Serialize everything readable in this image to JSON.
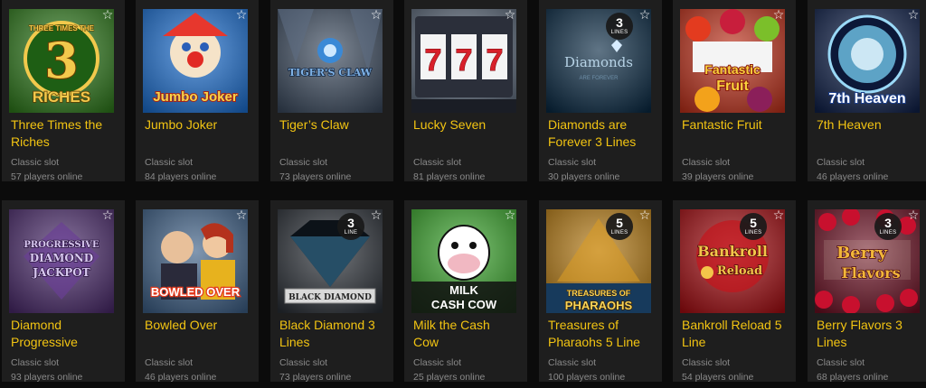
{
  "games": [
    {
      "title": "Three Times the Riches",
      "category": "Classic slot",
      "players": "57 players online",
      "art_text": [
        "THREE TIMES THE",
        "3",
        "RICHES"
      ],
      "colors": {
        "bg": "#2f7a1c",
        "accent": "#f2c94c"
      },
      "badge": null
    },
    {
      "title": "Jumbo Joker",
      "category": "Classic slot",
      "players": "84 players online",
      "art_text": [
        "Jumbo Joker"
      ],
      "colors": {
        "bg": "#1c6fd1",
        "accent": "#f7d54a"
      },
      "badge": null
    },
    {
      "title": "Tiger’s Claw",
      "category": "Classic slot",
      "players": "73 players online",
      "art_text": [
        "TIGER'S CLAW"
      ],
      "colors": {
        "bg": "#3b4a5e",
        "accent": "#7fb2e6"
      },
      "badge": null
    },
    {
      "title": "Lucky Seven",
      "category": "Classic slot",
      "players": "81 players online",
      "art_text": [
        "7",
        "7",
        "7"
      ],
      "colors": {
        "bg": "#5a6778",
        "accent": "#d8202a"
      },
      "badge": null
    },
    {
      "title": "Diamonds are Forever 3 Lines",
      "category": "Classic slot",
      "players": "30 players online",
      "art_text": [
        "Diamonds",
        "ARE FOREVER"
      ],
      "colors": {
        "bg": "#0a2a44",
        "accent": "#b7d3e6"
      },
      "badge": {
        "num": "3",
        "label": "LINES"
      }
    },
    {
      "title": "Fantastic Fruit",
      "category": "Classic slot",
      "players": "39 players online",
      "art_text": [
        "Fantastic",
        "Fruit"
      ],
      "colors": {
        "bg": "#c0321c",
        "accent": "#f9d23d"
      },
      "badge": null
    },
    {
      "title": "7th Heaven",
      "category": "Classic slot",
      "players": "46 players online",
      "art_text": [
        "7th Heaven"
      ],
      "colors": {
        "bg": "#10214a",
        "accent": "#78d1f5"
      },
      "badge": null
    },
    {
      "title": "Diamond Progressive",
      "category": "Classic slot",
      "players": "93 players online",
      "art_text": [
        "PROGRESSIVE",
        "DIAMOND",
        "JACKPOT"
      ],
      "colors": {
        "bg": "#4a2a6b",
        "accent": "#d8c8f0"
      },
      "badge": null
    },
    {
      "title": "Bowled Over",
      "category": "Classic slot",
      "players": "46 players online",
      "art_text": [
        "BOWLED OVER"
      ],
      "colors": {
        "bg": "#3d5f86",
        "accent": "#e33b1f"
      },
      "badge": null
    },
    {
      "title": "Black Diamond 3 Lines",
      "category": "Classic slot",
      "players": "73 players online",
      "art_text": [
        "BLACK DIAMOND"
      ],
      "colors": {
        "bg": "#2a2f36",
        "accent": "#3d7fa8"
      },
      "badge": {
        "num": "3",
        "label": "LINE"
      }
    },
    {
      "title": "Milk the Cash Cow",
      "category": "Classic slot",
      "players": "25 players online",
      "art_text": [
        "MILK",
        "CASH COW"
      ],
      "colors": {
        "bg": "#3aa52c",
        "accent": "#ffffff"
      },
      "badge": null
    },
    {
      "title": "Treasures of Pharaohs 5 Line",
      "category": "Classic slot",
      "players": "100 players online",
      "art_text": [
        "TREASURES OF",
        "PHARAOHS"
      ],
      "colors": {
        "bg": "#b57a12",
        "accent": "#f6d35a"
      },
      "badge": {
        "num": "5",
        "label": "LINES"
      }
    },
    {
      "title": "Bankroll Reload 5 Line",
      "category": "Classic slot",
      "players": "54 players online",
      "art_text": [
        "Bankroll",
        "Reload"
      ],
      "colors": {
        "bg": "#a50d12",
        "accent": "#f3c54a"
      },
      "badge": {
        "num": "5",
        "label": "LINES"
      }
    },
    {
      "title": "Berry Flavors 3 Lines",
      "category": "Classic slot",
      "players": "68 players online",
      "art_text": [
        "Berry",
        "Flavors"
      ],
      "colors": {
        "bg": "#6b0f22",
        "accent": "#f2b73a"
      },
      "badge": {
        "num": "3",
        "label": "LINES"
      }
    }
  ],
  "favorite_icon": "star-outline-icon",
  "colors": {
    "page_bg": "#0b0b0b",
    "card_bg": "#1e1e1e",
    "title": "#f2c412",
    "meta": "#8a8a8a"
  }
}
